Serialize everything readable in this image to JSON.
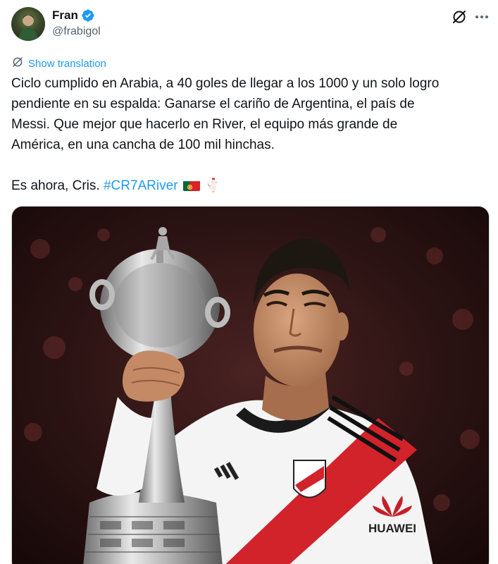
{
  "author": {
    "display_name": "Fran",
    "handle": "@frabigol",
    "verified": true
  },
  "actions": {
    "grok_icon": "grok-icon",
    "more_icon": "more-options-icon"
  },
  "translation": {
    "label": "Show translation"
  },
  "tweet": {
    "line1": "Ciclo cumplido en Arabia, a 40 goles de llegar a los 1000 y un solo logro",
    "line2": "pendiente en su espalda: Ganarse el cariño de Argentina, el país de",
    "line3": "Messi. Que mejor que hacerlo en River, el equipo más grande de",
    "line4": "América, en una cancha de 100 mil hinchas.",
    "line5_prefix": "Es ahora, Cris. ",
    "hashtag": "#CR7ARiver",
    "emojis": [
      "portugal-flag",
      "rooster"
    ]
  },
  "media": {
    "shirt_sponsor": "HUAWEI"
  },
  "colors": {
    "accent": "#1d9bf0",
    "text": "#0f1419",
    "secondary": "#536471",
    "river_red": "#d2232a"
  }
}
